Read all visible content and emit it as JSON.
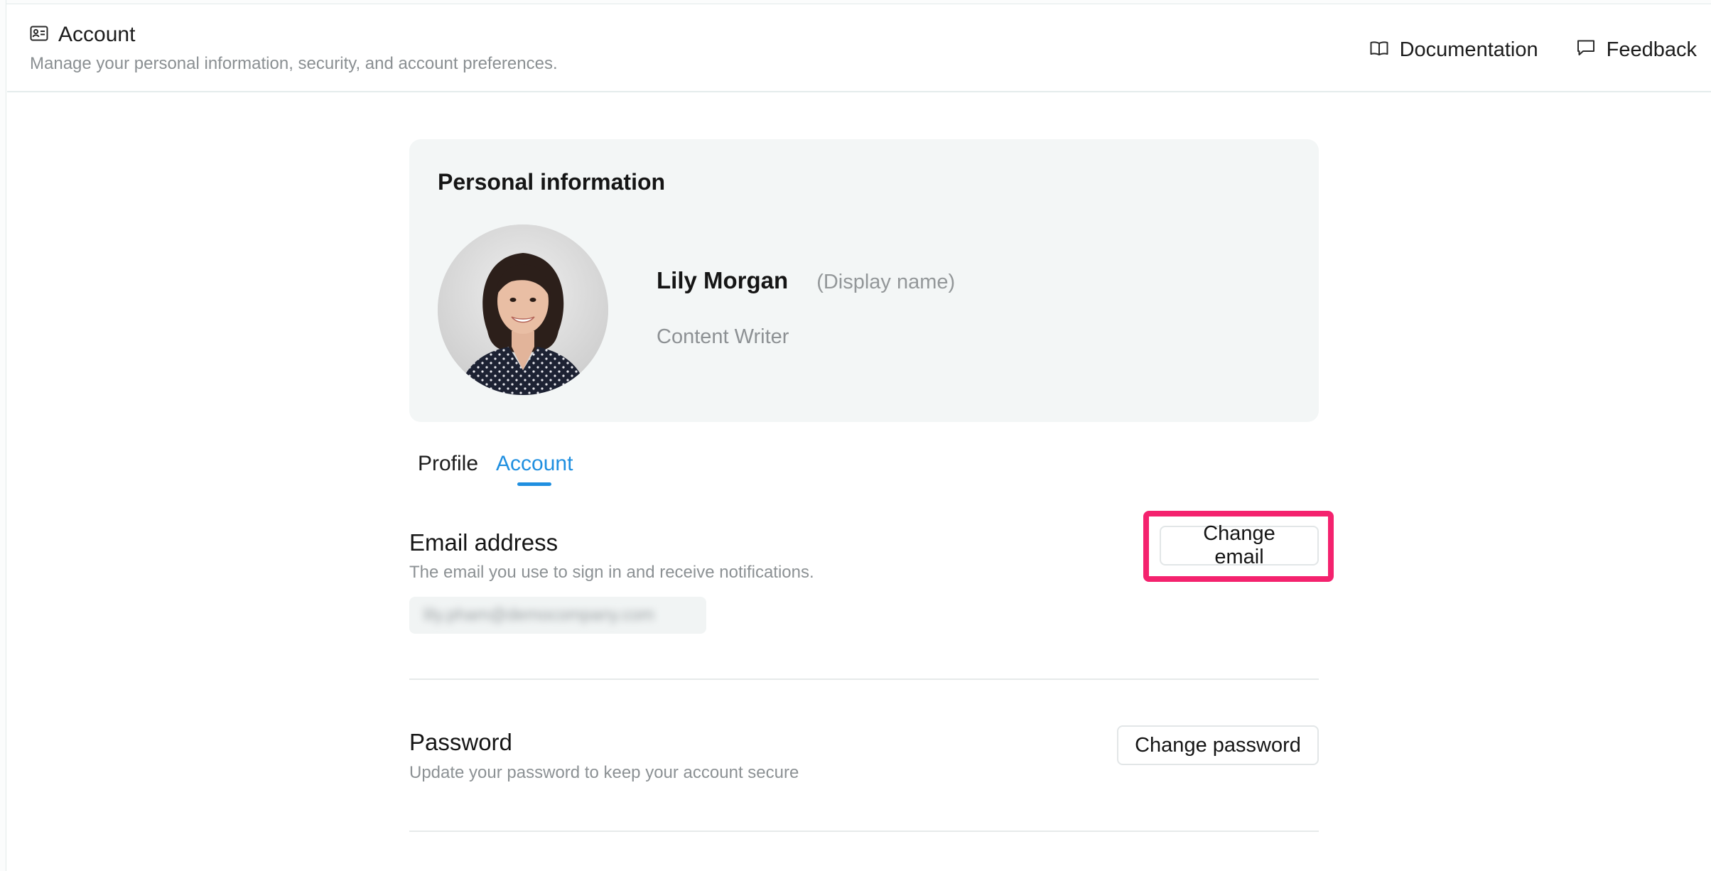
{
  "header": {
    "title": "Account",
    "subtitle": "Manage your personal information, security, and account preferences.",
    "actions": [
      {
        "label": "Documentation",
        "icon": "book-open-icon"
      },
      {
        "label": "Feedback",
        "icon": "message-square-icon"
      }
    ]
  },
  "personal_info": {
    "title": "Personal information",
    "name": "Lily Morgan",
    "display_hint": "(Display name)",
    "role": "Content Writer"
  },
  "tabs": [
    {
      "label": "Profile",
      "active": false
    },
    {
      "label": "Account",
      "active": true
    }
  ],
  "email_section": {
    "title": "Email address",
    "description": "The email you use to sign in and receive notifications.",
    "value": "lily.pham@democompany.com",
    "button_label": "Change email"
  },
  "password_section": {
    "title": "Password",
    "description": "Update your password to keep your account secure",
    "button_label": "Change password"
  },
  "colors": {
    "accent": "#1f8fe0",
    "highlight": "#f4226e",
    "card_bg": "#f3f6f6"
  }
}
